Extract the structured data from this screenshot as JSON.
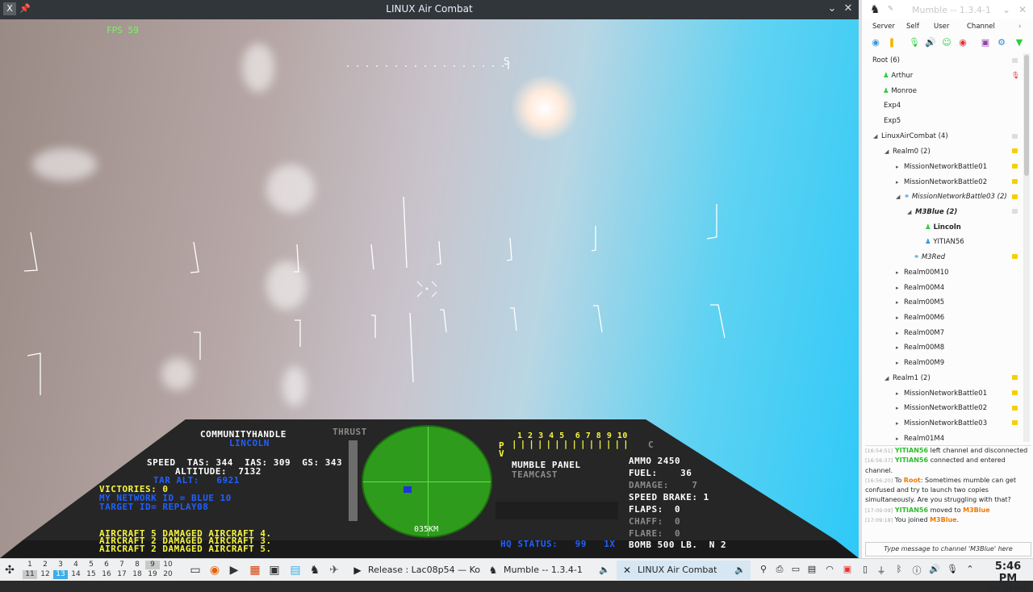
{
  "game_window": {
    "title": "LINUX Air Combat",
    "fps": "FPS  59",
    "compass_label": "S",
    "hud": {
      "callsign_label": "COMMUNITYHANDLE",
      "callsign": "LINCOLN",
      "thrust_label": "THRUST",
      "speed_line": "SPEED  TAS: 344  IAS: 309  GS: 343",
      "altitude_line": "ALTITUDE:  7132",
      "tar_alt_line": "TAR ALT:   6921",
      "victories_line": "VICTORIES: 0",
      "network_id_line": "MY NETWORK ID = BLUE 10",
      "target_id_line": "TARGET ID= REPLAY08",
      "messages": [
        "AIRCRAFT 5 DAMAGED AIRCRAFT 4.",
        "AIRCRAFT 2 DAMAGED AIRCRAFT 3.",
        "AIRCRAFT 2 DAMAGED AIRCRAFT 5."
      ],
      "radar_range": "035KM",
      "panel_numbers": "1 2 3 4 5  6 7 8 9 10",
      "panel_p": "P",
      "panel_v": "V",
      "panel_c": "C",
      "mumble_panel_label": "MUMBLE PANEL",
      "teamcast_label": "TEAMCAST",
      "hq_status_line": "HQ STATUS:   99   1X",
      "ammo_line": "AMMO 2450",
      "fuel_line": "FUEL:    36",
      "damage_line": "DAMAGE:    7",
      "speed_brake_line": "SPEED BRAKE: 1",
      "flaps_line": "FLAPS:  0",
      "chaff_line": "CHAFF:  0",
      "flare_line": "FLARE:  0",
      "bomb_line": "BOMB 500 LB.  N 2"
    }
  },
  "mumble": {
    "title": "Mumble -- 1.3.4-1",
    "menu": [
      "Server",
      "Self",
      "User",
      "Channel"
    ],
    "tree": [
      {
        "label": "Root (6)"
      },
      {
        "label": "Arthur"
      },
      {
        "label": "Monroe"
      },
      {
        "label": "Exp4"
      },
      {
        "label": "Exp5"
      },
      {
        "label": "LinuxAirCombat (4)"
      },
      {
        "label": "Realm0 (2)"
      },
      {
        "label": "MissionNetworkBattle01"
      },
      {
        "label": "MissionNetworkBattle02"
      },
      {
        "label": "MissionNetworkBattle03 (2)"
      },
      {
        "label": "M3Blue (2)"
      },
      {
        "label": "Lincoln"
      },
      {
        "label": "YITIAN56"
      },
      {
        "label": "M3Red"
      },
      {
        "label": "Realm00M10"
      },
      {
        "label": "Realm00M4"
      },
      {
        "label": "Realm00M5"
      },
      {
        "label": "Realm00M6"
      },
      {
        "label": "Realm00M7"
      },
      {
        "label": "Realm00M8"
      },
      {
        "label": "Realm00M9"
      },
      {
        "label": "Realm1 (2)"
      },
      {
        "label": "MissionNetworkBattle01"
      },
      {
        "label": "MissionNetworkBattle02"
      },
      {
        "label": "MissionNetworkBattle03"
      },
      {
        "label": "Realm01M4"
      }
    ],
    "log": {
      "l1_ts": "[16:54:51]",
      "l1_user": "YITIAN56",
      "l1_text": " left channel and disconnected",
      "l2_ts": "[16:56:37]",
      "l2_user": "YITIAN56",
      "l2_text": " connected and entered channel.",
      "l3_ts": "[16:56:20]",
      "l3_pre": " To ",
      "l3_chan": "Root",
      "l3_text": ": Sometimes mumble can get confused and try to launch two copies simultaneously. Are you struggling with that?",
      "l4_ts": "[17:09:09]",
      "l4_user": "YITIAN56",
      "l4_mid": " moved to ",
      "l4_chan": "M3Blue",
      "l5_ts": "[17:09:18]",
      "l5_text": " You joined ",
      "l5_chan": "M3Blue",
      "l5_end": "."
    },
    "input_placeholder": "Type message to channel 'M3Blue' here"
  },
  "taskbar": {
    "desktops_top": [
      "1",
      "2",
      "3",
      "4",
      "5",
      "6",
      "7",
      "8",
      "9",
      "10"
    ],
    "desktops_bottom": [
      "11",
      "12",
      "13",
      "14",
      "15",
      "16",
      "17",
      "18",
      "19",
      "20"
    ],
    "tasks": [
      "Release : Lac08p54 — Ko...",
      "Mumble -- 1.3.4-1",
      "LINUX Air Combat"
    ],
    "clock_time": "5:46 PM",
    "clock_date": "Thu 1/13/22"
  }
}
